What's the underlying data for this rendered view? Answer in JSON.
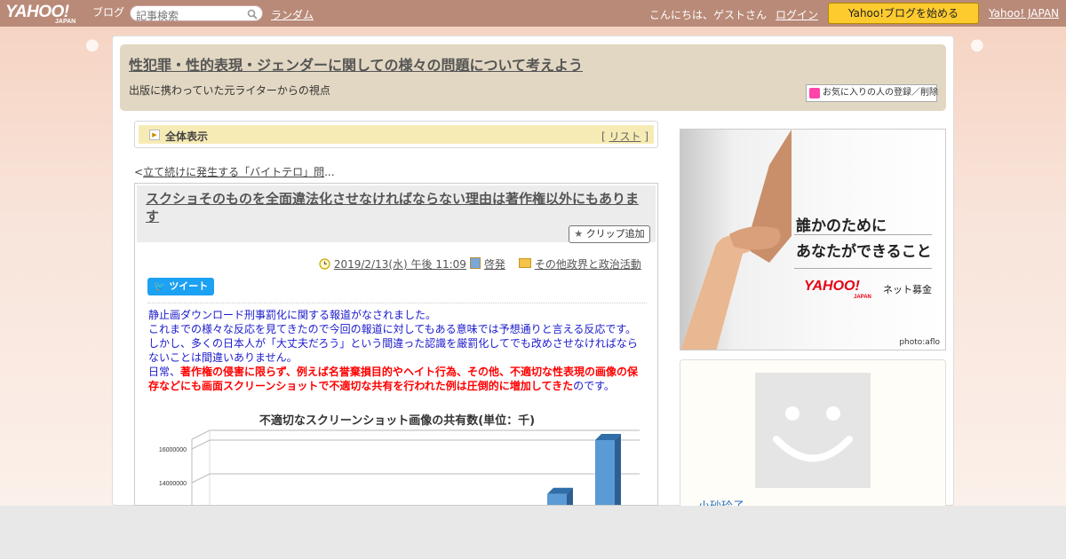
{
  "topbar": {
    "logo_text": "YAHOO!",
    "logo_sub": "JAPAN",
    "blog_label": "ブログ",
    "search_placeholder": "記事検索",
    "random_label": "ランダム",
    "greeting": "こんにちは、ゲストさん",
    "login_label": "ログイン",
    "start_blog_label": "Yahoo!ブログを始める",
    "yahoo_japan_label": "Yahoo! JAPAN"
  },
  "header": {
    "title": "性犯罪・性的表現・ジェンダーに関しての様々の問題について考えよう",
    "subtitle": "出版に携わっていた元ライターからの視点",
    "favorite_label": "お気に入りの人の登録／削除"
  },
  "allbar": {
    "label": "全体表示",
    "list_open": "[ ",
    "list_label": "リスト",
    "list_close": " ]"
  },
  "prev": {
    "lt": "<",
    "label": "立て続けに発生する「バイトテロ」問",
    "ellipsis": "..."
  },
  "article": {
    "title": "スクショそのものを全面違法化させなければならない理由は著作権以外にもあります",
    "clip_label": "クリップ追加",
    "date": "2019/2/13(水) 午後 11:09",
    "category1": "啓発",
    "category2": "その他政界と政治活動",
    "tweet_label": "ツイート",
    "para1": "静止画ダウンロード刑事罰化に関する報道がなされました。",
    "para2": "これまでの様々な反応を見てきたので今回の報道に対してもある意味では予想通りと言える反応です。",
    "para3": "しかし、多くの日本人が「大丈夫だろう」という間違った認識を厳罰化してでも改めさせなければならないことは間違いありません。",
    "para4_prefix": "日常、",
    "para4_red": "著作権の侵害に限らず、例えば名誉棄損目的やヘイト行為、その他、不適切な性表現の画像の保存などにも画面スクリーンショットで不適切な共有を行われた例は圧倒的に増加してきた",
    "para4_suffix": "のです。"
  },
  "chart_data": {
    "type": "bar",
    "title": "不適切なスクリーンショット画像の共有数(単位：千)",
    "y_ticks": [
      "16000000",
      "14000000"
    ],
    "values": [
      12800000,
      16000000
    ],
    "visible_range": [
      12000000,
      17000000
    ],
    "bar_color": "#5b9bd5"
  },
  "sidebar": {
    "ad_line1": "誰かのために",
    "ad_line2": "あなたができること",
    "ad_brand": "YAHOO!",
    "ad_brand_sub": "JAPAN",
    "ad_service": "ネット募金",
    "ad_credit": "photo:aflo",
    "profile_name": "小砂玲子"
  }
}
